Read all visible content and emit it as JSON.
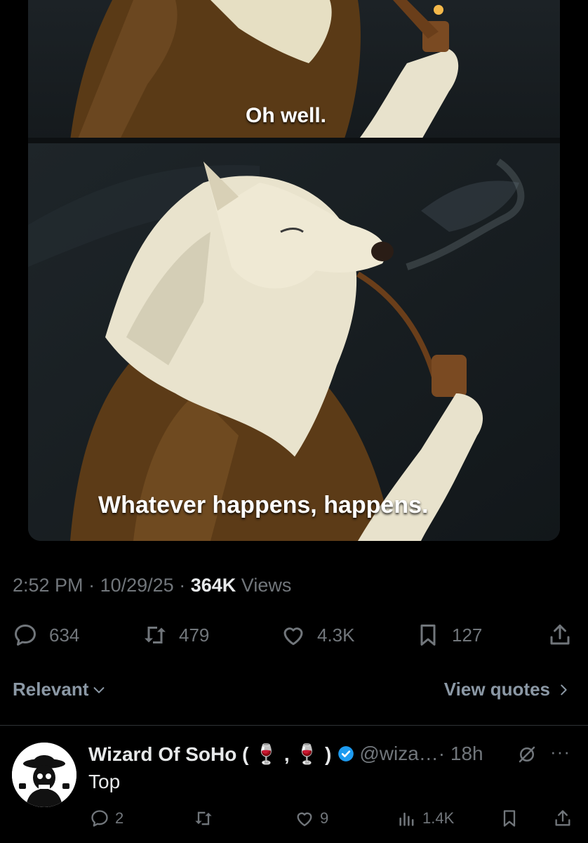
{
  "media": {
    "caption_top": "Oh well.",
    "caption_bottom": "Whatever happens, happens."
  },
  "tweet": {
    "time": "2:52 PM",
    "date": "10/29/25",
    "views_count": "364K",
    "views_label": "Views",
    "separator": "·"
  },
  "actions": {
    "replies": "634",
    "reposts": "479",
    "likes": "4.3K",
    "bookmarks": "127"
  },
  "sort": {
    "label": "Relevant",
    "view_quotes": "View quotes"
  },
  "reply": {
    "display_name": "Wizard Of SoHo ( 🍷 , 🍷 )",
    "handle": "@wiza…",
    "time": "· 18h",
    "more": "···",
    "text": "Top",
    "replies": "2",
    "reposts": "",
    "likes": "9",
    "views": "1.4K"
  },
  "colors": {
    "background": "#000000",
    "muted": "#71767b",
    "text": "#e7e9ea",
    "verified": "#1d9bf0"
  },
  "icons": [
    "reply-icon",
    "retweet-icon",
    "heart-icon",
    "bookmark-icon",
    "share-icon",
    "chevron-down-icon",
    "chevron-right-icon",
    "verified-icon",
    "grok-icon",
    "views-icon"
  ]
}
